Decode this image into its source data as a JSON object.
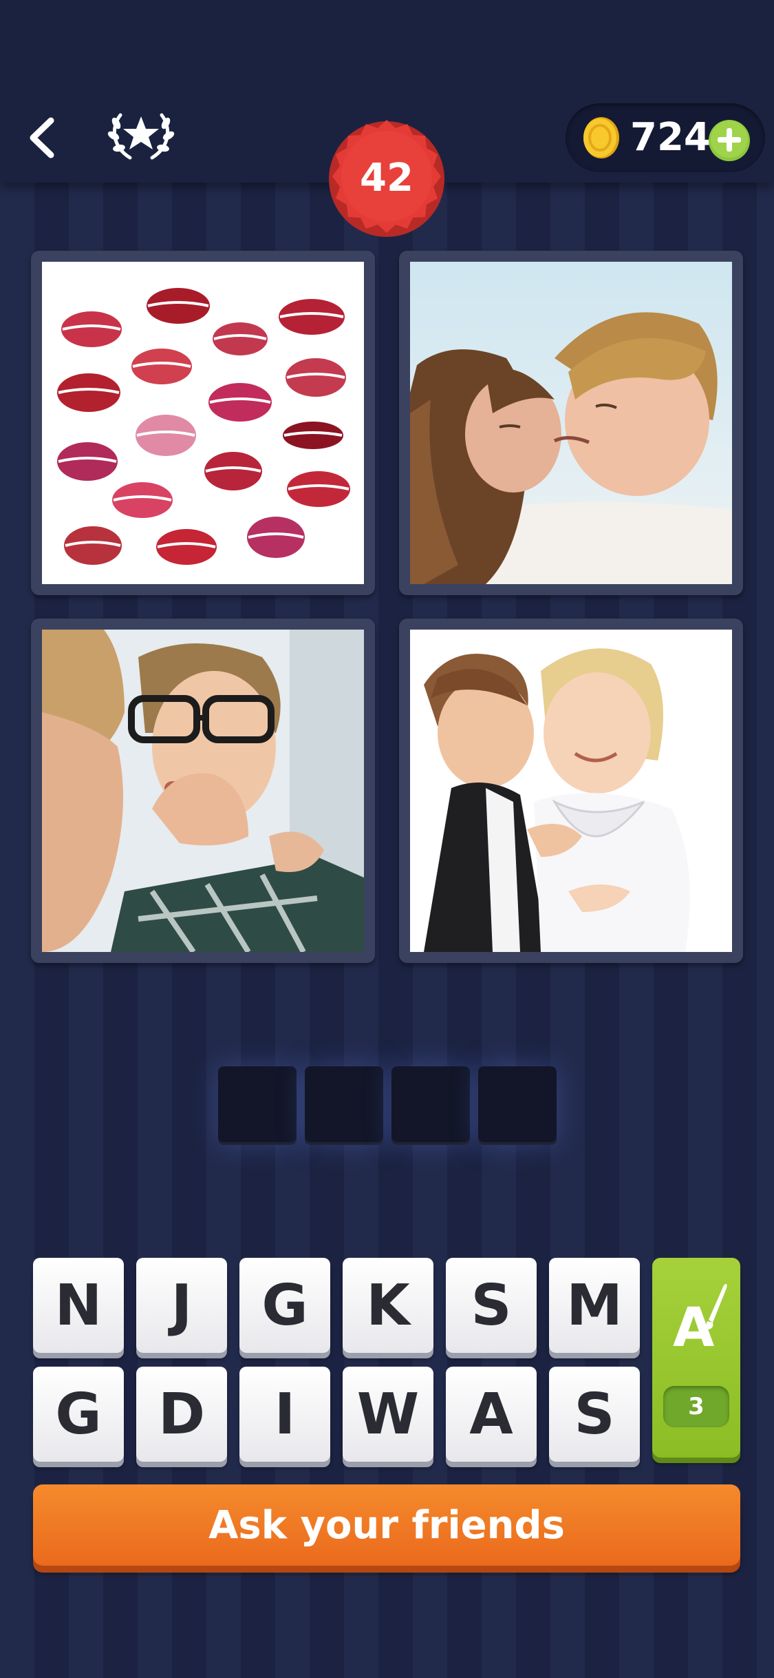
{
  "header": {
    "level": "42",
    "coins": "724"
  },
  "puzzle": {
    "images": [
      "lipstick-kiss-marks",
      "couple-kissing",
      "woman-kissing-man-cheek",
      "children-kiss-on-cheek"
    ],
    "answer_length": 4,
    "answer_slots": [
      "",
      "",
      "",
      ""
    ]
  },
  "keyboard": {
    "row1": [
      "N",
      "J",
      "G",
      "K",
      "S",
      "M"
    ],
    "row2": [
      "G",
      "D",
      "I",
      "W",
      "A",
      "S"
    ],
    "hint_count": "3"
  },
  "actions": {
    "ask_label": "Ask your friends"
  },
  "colors": {
    "background": "#1f2747",
    "level_badge": "#e53b36",
    "hint_green": "#9ac92f",
    "ask_orange": "#f07d27",
    "coin_gold": "#f5c22a"
  }
}
